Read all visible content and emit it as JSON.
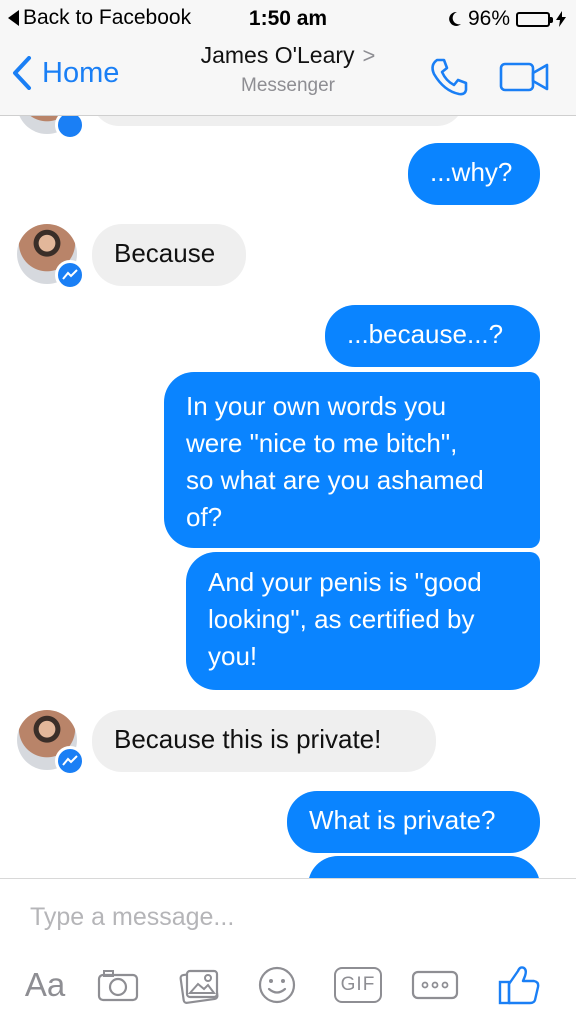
{
  "status_bar": {
    "back_label": "Back to Facebook",
    "time": "1:50 am",
    "battery": "96%",
    "battery_level": 0.96
  },
  "header": {
    "home_label": "Home",
    "contact_name": "James O'Leary",
    "chevron": ">",
    "subtitle": "Messenger"
  },
  "messages": [
    {
      "from": "me",
      "text": "...why?"
    },
    {
      "from": "them",
      "text": "Because"
    },
    {
      "from": "me",
      "text": "...because...?"
    },
    {
      "from": "me",
      "lines": [
        "In your own words you",
        "were \"nice to me bitch\",",
        "so what are you ashamed",
        "of?"
      ]
    },
    {
      "from": "me",
      "lines": [
        "And your penis is \"good",
        "looking\", as certified by",
        "you!"
      ]
    },
    {
      "from": "them",
      "text": "Because this is private!"
    },
    {
      "from": "me",
      "text": "What is private?"
    }
  ],
  "composer": {
    "placeholder": "Type a message...",
    "aa_label": "Aa",
    "gif_label": "GIF"
  },
  "colors": {
    "accent": "#1a7ff5",
    "outgoing_bubble": "#0a84ff",
    "incoming_bubble": "#efefef",
    "icon_gray": "#8e8e93"
  },
  "icons": [
    "camera-icon",
    "image-icon",
    "emoji-icon",
    "gif-icon",
    "more-icon",
    "like-icon",
    "phone-icon",
    "video-icon",
    "messenger-badge-icon"
  ]
}
